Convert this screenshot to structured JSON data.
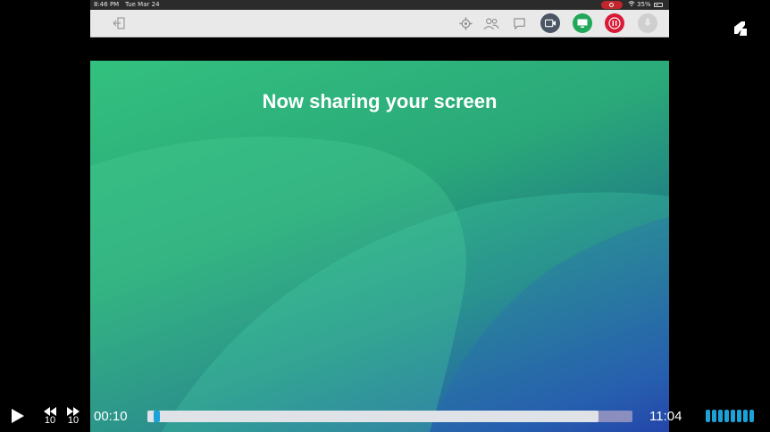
{
  "device_status": {
    "time": "8:46 PM",
    "date": "Tue Mar 24",
    "battery": "35%"
  },
  "toolbar": {
    "icons": [
      "exit-icon",
      "settings-icon",
      "participants-icon",
      "chat-icon",
      "camera-icon",
      "screen-share-icon",
      "pause-icon",
      "microphone-icon"
    ],
    "colors": {
      "camera": "#4b5563",
      "share": "#22a85a",
      "pause": "#d91a36",
      "mic": "#cfcfcf"
    }
  },
  "slide": {
    "title": "Now sharing your screen",
    "colors": {
      "top": "#33c17f",
      "bottom": "#16119e"
    }
  },
  "player": {
    "current_time": "00:10",
    "total_time": "11:04",
    "skip_back": "10",
    "skip_forward": "10",
    "progress": 0.012,
    "buffered": 0.93,
    "volume_bars": 8,
    "accent_color": "#1ba3d8"
  }
}
